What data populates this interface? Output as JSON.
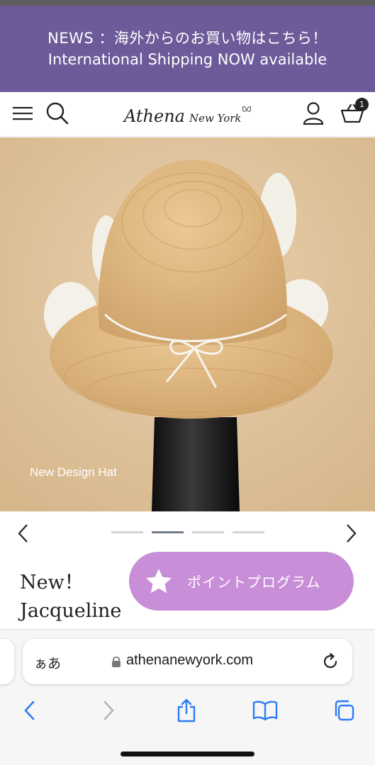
{
  "news": {
    "line1": "NEWS ：海外からのお買い物はこちら！",
    "line2": "International Shipping NOW available"
  },
  "header": {
    "logo_main": "Athena",
    "logo_sub": "New York",
    "cart_count": "1"
  },
  "hero": {
    "caption": "New Design Hat",
    "slide_count": 4,
    "active_slide": 2
  },
  "product": {
    "title_line1": "New！",
    "title_line2": "Jacqueline"
  },
  "points_button": {
    "label": "ポイントプログラム"
  },
  "browser": {
    "aa_label": "ぁあ",
    "url": "athenanewyork.com"
  },
  "colors": {
    "news_bg": "#6d5a99",
    "points_bg": "#c98ed8",
    "ios_blue": "#2d7cf6"
  },
  "icons": [
    "menu-icon",
    "search-icon",
    "account-icon",
    "cart-icon",
    "chevron-left-icon",
    "chevron-right-icon",
    "star-icon",
    "lock-icon",
    "reload-icon",
    "share-icon",
    "bookmarks-icon",
    "tabs-icon"
  ]
}
